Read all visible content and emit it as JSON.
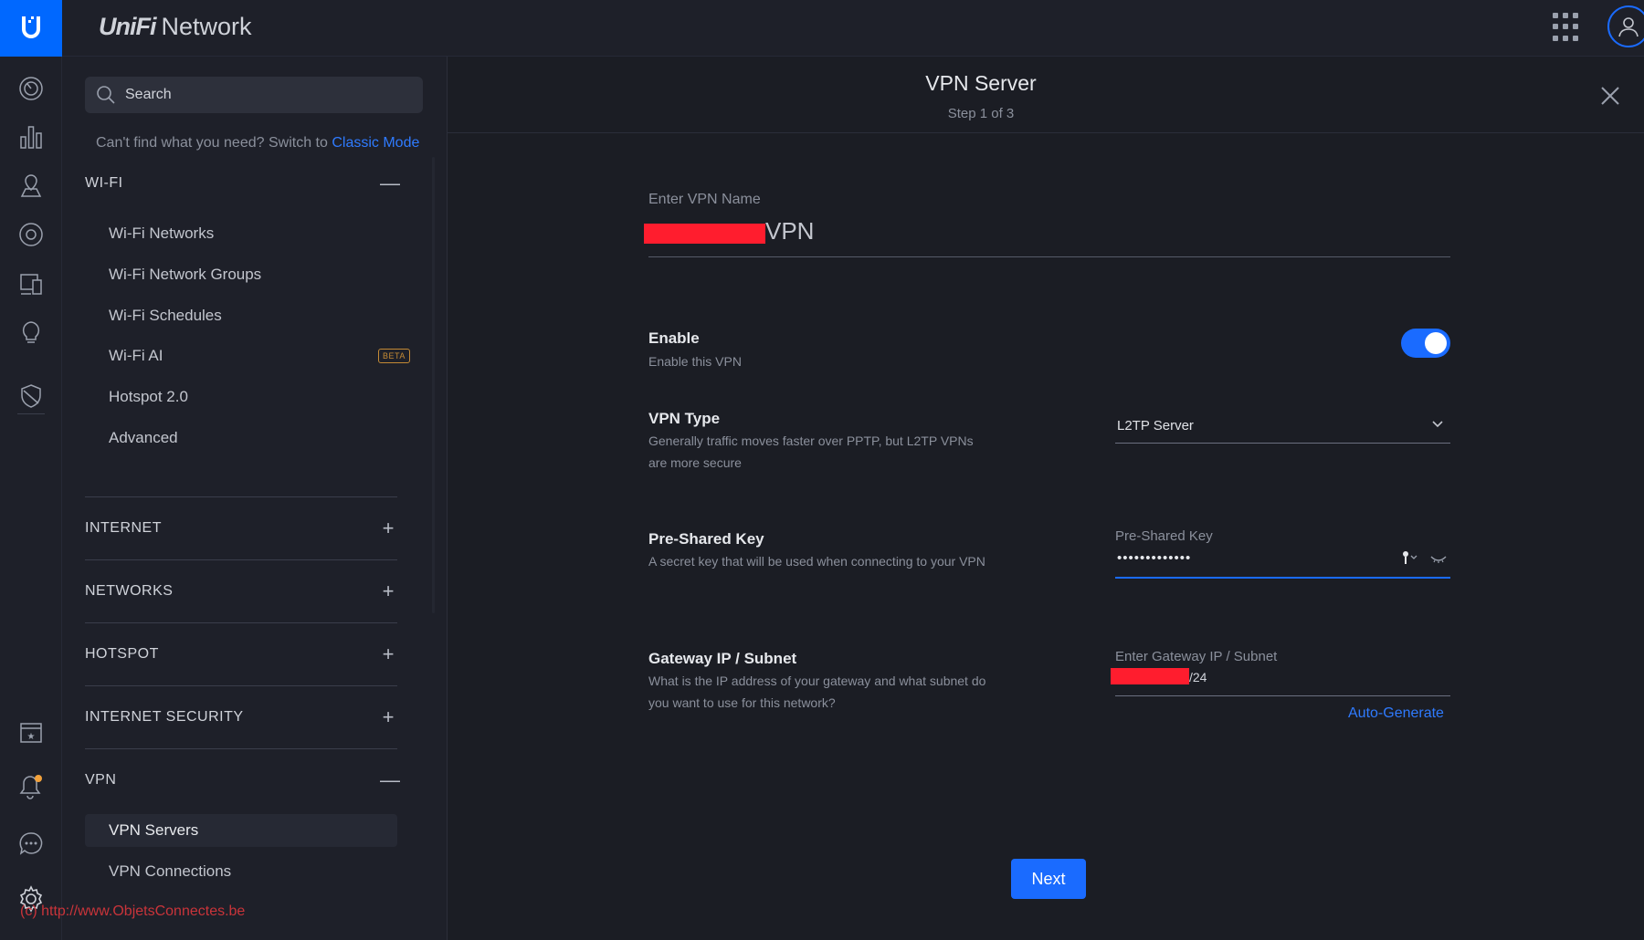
{
  "app": {
    "brand_unifi": "UniFi",
    "brand_network": "Network"
  },
  "rail": {
    "icons": [
      "dashboard-icon",
      "statistics-icon",
      "topology-icon",
      "devices-icon",
      "clients-icon",
      "insights-icon",
      "security-icon",
      "events-icon",
      "notifications-icon",
      "support-chat-icon",
      "settings-icon"
    ],
    "notification_color": "#f2a13b"
  },
  "sidebar": {
    "search_placeholder": "Search",
    "hint_text": "Can't find what you need? Switch to",
    "hint_link": "Classic Mode",
    "sections": {
      "wifi": {
        "title": "WI-FI",
        "toggle": "—",
        "items": [
          "Wi-Fi Networks",
          "Wi-Fi Network Groups",
          "Wi-Fi Schedules",
          "Wi-Fi AI",
          "Hotspot 2.0",
          "Advanced"
        ],
        "beta_badge": "BETA"
      },
      "internet": {
        "title": "INTERNET",
        "toggle": "+"
      },
      "networks": {
        "title": "NETWORKS",
        "toggle": "+"
      },
      "hotspot": {
        "title": "HOTSPOT",
        "toggle": "+"
      },
      "internet_security": {
        "title": "INTERNET SECURITY",
        "toggle": "+"
      },
      "vpn": {
        "title": "VPN",
        "toggle": "—",
        "items": [
          "VPN Servers",
          "VPN Connections"
        ]
      }
    },
    "watermark": "(c) http://www.ObjetsConnectes.be"
  },
  "panel": {
    "title": "VPN Server",
    "step": "Step 1 of 3",
    "vpn_name": {
      "label": "Enter VPN Name",
      "value_visible_suffix": "VPN"
    },
    "enable": {
      "title": "Enable",
      "desc": "Enable this VPN",
      "on": true
    },
    "vpn_type": {
      "title": "VPN Type",
      "desc": "Generally traffic moves faster over PPTP, but L2TP VPNs are more secure",
      "selected": "L2TP Server"
    },
    "psk": {
      "title": "Pre-Shared Key",
      "desc": "A secret key that will be used when connecting to your VPN",
      "label": "Pre-Shared Key",
      "masked_value": "•••••••••••••"
    },
    "gateway": {
      "title": "Gateway IP / Subnet",
      "desc": "What is the IP address of your gateway and what subnet do you want to use for this network?",
      "label": "Enter Gateway IP / Subnet",
      "value_visible_suffix": "/24",
      "auto_generate": "Auto-Generate"
    },
    "next_label": "Next"
  },
  "colors": {
    "accent": "#1a6bff",
    "redaction": "#ff1d2e",
    "background": "#1b1d24"
  }
}
